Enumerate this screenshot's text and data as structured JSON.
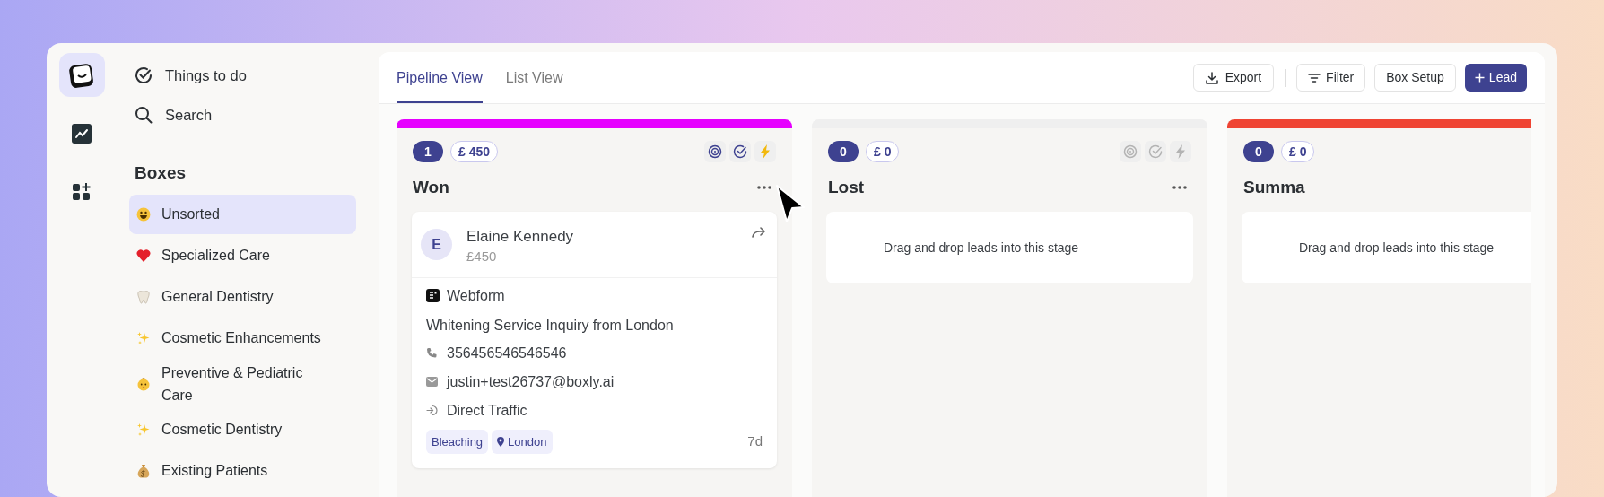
{
  "rail": [
    {
      "kind": "logo",
      "selected": true
    },
    {
      "kind": "chart",
      "selected": false
    },
    {
      "kind": "apps",
      "selected": false
    }
  ],
  "sidebar": {
    "nav": [
      {
        "kind": "check",
        "label": "Things to do"
      },
      {
        "kind": "search",
        "label": "Search"
      }
    ],
    "section_title": "Boxes",
    "boxes": [
      {
        "kind": "smiley",
        "label": "Unsorted",
        "selected": true
      },
      {
        "kind": "heart",
        "label": "Specialized Care",
        "selected": false
      },
      {
        "kind": "tooth",
        "label": "General Dentistry",
        "selected": false
      },
      {
        "kind": "sparkles",
        "label": "Cosmetic Enhancements",
        "selected": false
      },
      {
        "kind": "baby",
        "label": "Preventive & Pediatric Care",
        "selected": false
      },
      {
        "kind": "sparkles",
        "label": "Cosmetic Dentistry",
        "selected": false
      },
      {
        "kind": "moneybag",
        "label": "Existing Patients",
        "selected": false
      }
    ]
  },
  "tabs": [
    {
      "label": "Pipeline View",
      "selected": true
    },
    {
      "label": "List View",
      "selected": false
    }
  ],
  "actions": [
    {
      "kind": "export",
      "label": "Export"
    },
    {
      "kind": "filter",
      "label": "Filter"
    },
    {
      "kind": "plain",
      "label": "Box Setup"
    },
    {
      "kind": "primary",
      "label": "Lead"
    }
  ],
  "columns": [
    {
      "title": "Won",
      "count": "1",
      "amount": "£ 450",
      "color": "#e600ff",
      "tools_active": true,
      "menu": true,
      "leads": [
        {
          "initial": "E",
          "name": "Elaine Kennedy",
          "value": "£450",
          "source": "Webform",
          "title": "Whitening Service Inquiry from London",
          "phone": "356456546546546",
          "email": "justin+test26737@boxly.ai",
          "channel": "Direct Traffic",
          "tags": [
            {
              "kind": "plain",
              "label": "Bleaching"
            },
            {
              "kind": "location",
              "label": "London"
            }
          ],
          "age": "7d"
        }
      ]
    },
    {
      "title": "Lost",
      "count": "0",
      "amount": "£ 0",
      "color": "#efefef",
      "tools_active": false,
      "menu": true,
      "empty_text": "Drag and drop leads into this stage"
    },
    {
      "title": "Summa",
      "count": "0",
      "amount": "£ 0",
      "color": "#ef4433",
      "menu": false,
      "empty_text": "Drag and drop leads into this stage"
    }
  ]
}
